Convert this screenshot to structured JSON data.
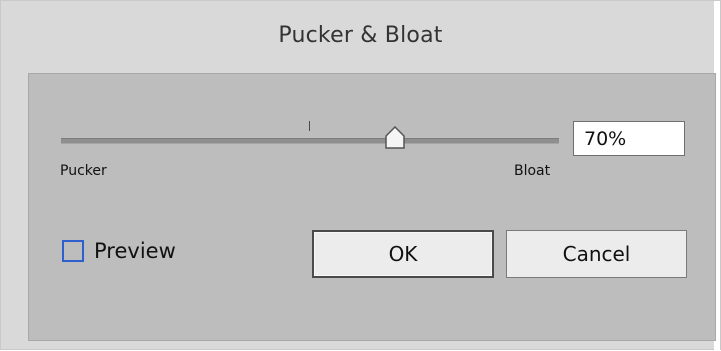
{
  "dialog": {
    "title": "Pucker & Bloat"
  },
  "slider": {
    "left_label": "Pucker",
    "right_label": "Bloat",
    "value_text": "70%",
    "position_fraction": 0.67
  },
  "preview": {
    "label": "Preview",
    "checked": false
  },
  "buttons": {
    "ok": "OK",
    "cancel": "Cancel"
  },
  "colors": {
    "dialog_bg": "#d9d9d9",
    "panel_bg": "#bdbdbd",
    "checkbox_border": "#2f5fcf"
  }
}
